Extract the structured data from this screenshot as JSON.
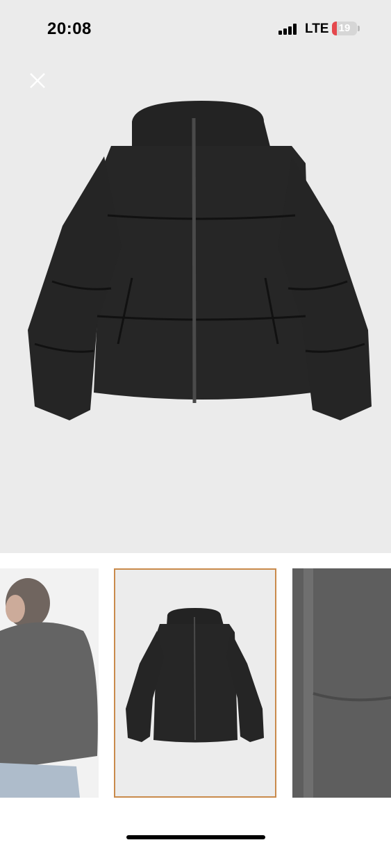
{
  "status_bar": {
    "time": "20:08",
    "network": "LTE",
    "battery_level": "19",
    "icons": [
      "signal-icon",
      "battery-icon"
    ]
  },
  "gallery": {
    "close_icon": "close-icon",
    "thumbnails": [
      {
        "name": "thumbnail-model",
        "selected": false
      },
      {
        "name": "thumbnail-product",
        "selected": true
      },
      {
        "name": "thumbnail-detail",
        "selected": false
      }
    ],
    "colors": {
      "background": "#ebebeb",
      "selected_border": "#c98a4b",
      "jacket": "#252525"
    }
  }
}
